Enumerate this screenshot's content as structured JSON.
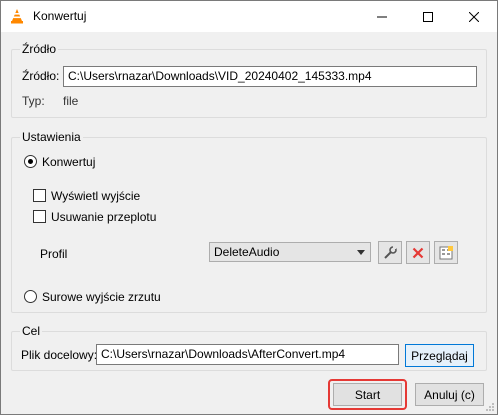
{
  "window": {
    "title": "Konwertuj"
  },
  "source": {
    "group_title": "Źródło",
    "label": "Źródło:",
    "path": "C:\\Users\\rnazar\\Downloads\\VID_20240402_145333.mp4",
    "type_label": "Typ:",
    "type_value": "file"
  },
  "settings": {
    "group_title": "Ustawienia",
    "convert_label": "Konwertuj",
    "show_output_label": "Wyświetl wyjście",
    "deinterlace_label": "Usuwanie przeplotu",
    "profile_label": "Profil",
    "profile_value": "DeleteAudio",
    "raw_dump_label": "Surowe wyjście zrzutu"
  },
  "destination": {
    "group_title": "Cel",
    "file_label": "Plik docelowy:",
    "file_path": "C:\\Users\\rnazar\\Downloads\\AfterConvert.mp4",
    "browse_label": "Przeglądaj"
  },
  "footer": {
    "start_label": "Start",
    "cancel_label": "Anuluj (c)"
  },
  "colors": {
    "highlight": "#e53935",
    "delete_icon": "#e53935",
    "vlc_orange": "#ff8800"
  }
}
